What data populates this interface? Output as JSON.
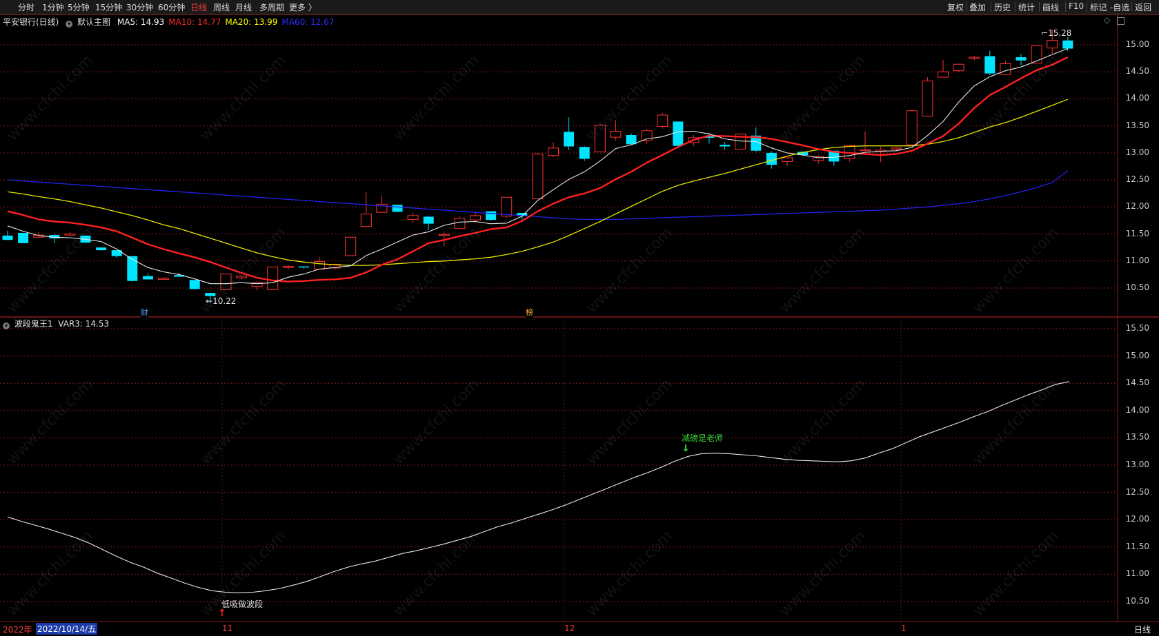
{
  "periods": [
    "分时",
    "1分钟",
    "5分钟",
    "15分钟",
    "30分钟",
    "60分钟",
    "日线",
    "周线",
    "月线",
    "多周期",
    "更多 〉"
  ],
  "active_period": "日线",
  "right_buttons": [
    "复权",
    "叠加",
    "历史",
    "统计",
    "画线",
    "F10",
    "标记",
    "-自选",
    "返回"
  ],
  "main_header": {
    "symbol": "平安银行(日线)",
    "template": "默认主图",
    "ma": [
      {
        "label": "MA5: 14.93",
        "color": "#ffffff"
      },
      {
        "label": "MA10: 14.77",
        "color": "#ff2a2a"
      },
      {
        "label": "MA20: 13.99",
        "color": "#ffff00"
      },
      {
        "label": "MA60: 12.67",
        "color": "#2b2bff"
      }
    ]
  },
  "indicator_header": {
    "name": "波段鬼王1",
    "value": "VAR3: 14.53"
  },
  "main_axis": [
    "15.00",
    "14.50",
    "14.00",
    "13.50",
    "13.00",
    "12.50",
    "12.00",
    "11.50",
    "11.00",
    "10.50"
  ],
  "sub_axis": [
    "15.50",
    "15.00",
    "14.50",
    "14.00",
    "13.50",
    "13.00",
    "12.50",
    "12.00",
    "11.50",
    "11.00",
    "10.50"
  ],
  "annotations": {
    "high": "15.28",
    "low": "10.22",
    "buy": "低吸做波段",
    "sell": "减磅是老师"
  },
  "event_markers": {
    "fin": "财",
    "rank": "榜"
  },
  "x_labels": {
    "year": "2022年",
    "date": "2022/10/14/五",
    "nov": "11",
    "dec": "12",
    "jan": "1",
    "period": "日线"
  },
  "watermark": "www.cfchi.com",
  "colors": {
    "up": "#ff3232",
    "down": "#00e5ff",
    "ma5": "#e8e8e8",
    "ma10": "#ff2020",
    "ma20": "#e6e600",
    "ma60": "#2222ee",
    "grid": "#8b1a1a",
    "var3": "#e8e8e8",
    "sell": "#3ad23a",
    "buy": "#ff2020"
  },
  "candles": [
    [
      11.47,
      11.56,
      11.39,
      11.39
    ],
    [
      11.52,
      11.52,
      11.33,
      11.33
    ],
    [
      11.44,
      11.54,
      11.44,
      11.48
    ],
    [
      11.48,
      11.5,
      11.33,
      11.42
    ],
    [
      11.48,
      11.54,
      11.48,
      11.5
    ],
    [
      11.47,
      11.47,
      11.33,
      11.34
    ],
    [
      11.25,
      11.25,
      11.19,
      11.2
    ],
    [
      11.2,
      11.2,
      11.06,
      11.09
    ],
    [
      11.09,
      11.09,
      10.62,
      10.63
    ],
    [
      10.72,
      10.77,
      10.66,
      10.66
    ],
    [
      10.68,
      10.7,
      10.66,
      10.68
    ],
    [
      10.74,
      10.78,
      10.7,
      10.71
    ],
    [
      10.65,
      10.65,
      10.48,
      10.48
    ],
    [
      10.41,
      10.41,
      10.22,
      10.35
    ],
    [
      10.47,
      10.76,
      10.47,
      10.76
    ],
    [
      10.69,
      10.72,
      10.66,
      10.72
    ],
    [
      10.53,
      10.62,
      10.46,
      10.6
    ],
    [
      10.47,
      10.89,
      10.47,
      10.89
    ],
    [
      10.9,
      10.93,
      10.84,
      10.9
    ],
    [
      10.9,
      10.9,
      10.86,
      10.88
    ],
    [
      10.85,
      11.07,
      10.85,
      10.99
    ],
    [
      10.87,
      10.95,
      10.84,
      10.94
    ],
    [
      11.1,
      11.44,
      11.1,
      11.44
    ],
    [
      11.64,
      12.27,
      11.64,
      11.87
    ],
    [
      11.9,
      12.21,
      11.9,
      12.05
    ],
    [
      12.04,
      12.04,
      11.9,
      11.91
    ],
    [
      11.77,
      11.9,
      11.7,
      11.84
    ],
    [
      11.82,
      11.84,
      11.57,
      11.69
    ],
    [
      11.49,
      11.54,
      11.27,
      11.49
    ],
    [
      11.6,
      11.83,
      11.6,
      11.79
    ],
    [
      11.76,
      11.91,
      11.71,
      11.84
    ],
    [
      11.92,
      11.92,
      11.74,
      11.76
    ],
    [
      11.83,
      12.19,
      11.8,
      12.18
    ],
    [
      11.89,
      11.89,
      11.75,
      11.83
    ],
    [
      12.15,
      13.0,
      12.15,
      12.98
    ],
    [
      12.95,
      13.2,
      12.92,
      13.09
    ],
    [
      13.39,
      13.66,
      13.05,
      13.12
    ],
    [
      13.11,
      13.12,
      12.85,
      12.89
    ],
    [
      13.02,
      13.53,
      13.02,
      13.51
    ],
    [
      13.29,
      13.61,
      13.23,
      13.4
    ],
    [
      13.33,
      13.36,
      13.17,
      13.16
    ],
    [
      13.23,
      13.44,
      13.16,
      13.41
    ],
    [
      13.49,
      13.74,
      13.45,
      13.7
    ],
    [
      13.58,
      13.58,
      13.09,
      13.13
    ],
    [
      13.19,
      13.33,
      13.13,
      13.28
    ],
    [
      13.31,
      13.37,
      13.17,
      13.28
    ],
    [
      13.15,
      13.2,
      13.06,
      13.12
    ],
    [
      13.07,
      13.36,
      13.07,
      13.35
    ],
    [
      13.32,
      13.47,
      13.02,
      13.04
    ],
    [
      13.0,
      13.03,
      12.71,
      12.78
    ],
    [
      12.84,
      12.9,
      12.76,
      12.91
    ],
    [
      13.02,
      13.03,
      12.94,
      12.96
    ],
    [
      12.86,
      12.96,
      12.8,
      12.93
    ],
    [
      13.04,
      13.04,
      12.76,
      12.84
    ],
    [
      12.89,
      13.15,
      12.84,
      13.14
    ],
    [
      13.05,
      13.4,
      13.05,
      13.06
    ],
    [
      13.03,
      13.11,
      12.83,
      13.05
    ],
    [
      13.08,
      13.1,
      13.04,
      13.09
    ],
    [
      13.15,
      13.78,
      13.15,
      13.78
    ],
    [
      13.68,
      14.4,
      13.68,
      14.33
    ],
    [
      14.4,
      14.72,
      14.4,
      14.5
    ],
    [
      14.52,
      14.65,
      14.5,
      14.64
    ],
    [
      14.76,
      14.8,
      14.71,
      14.77
    ],
    [
      14.79,
      14.89,
      14.44,
      14.47
    ],
    [
      14.45,
      14.7,
      14.45,
      14.65
    ],
    [
      14.77,
      14.83,
      14.62,
      14.71
    ],
    [
      14.66,
      14.98,
      14.66,
      14.98
    ],
    [
      14.94,
      15.28,
      14.84,
      15.08
    ],
    [
      15.08,
      15.14,
      14.88,
      14.93
    ]
  ],
  "ma5": [
    11.65,
    11.55,
    11.47,
    11.44,
    11.43,
    11.4,
    11.36,
    11.22,
    11.03,
    10.88,
    10.8,
    10.75,
    10.67,
    10.58,
    10.58,
    10.6,
    10.58,
    10.6,
    10.7,
    10.76,
    10.85,
    10.88,
    10.91,
    11.1,
    11.22,
    11.35,
    11.48,
    11.54,
    11.66,
    11.72,
    11.73,
    11.69,
    11.7,
    11.83,
    12.12,
    12.32,
    12.51,
    12.65,
    12.85,
    13.08,
    13.15,
    13.26,
    13.3,
    13.39,
    13.4,
    13.35,
    13.26,
    13.22,
    13.21,
    13.09,
    13.0,
    12.96,
    12.91,
    12.92,
    12.95,
    13.01,
    13.03,
    13.04,
    13.1,
    13.32,
    13.58,
    13.94,
    14.24,
    14.41,
    14.52,
    14.59,
    14.7,
    14.82,
    14.93
  ],
  "ma10": [
    11.92,
    11.85,
    11.77,
    11.73,
    11.71,
    11.67,
    11.62,
    11.55,
    11.43,
    11.31,
    11.22,
    11.14,
    11.07,
    10.98,
    10.88,
    10.78,
    10.69,
    10.64,
    10.62,
    10.63,
    10.65,
    10.66,
    10.69,
    10.79,
    10.93,
    11.03,
    11.18,
    11.33,
    11.39,
    11.46,
    11.52,
    11.59,
    11.62,
    11.74,
    11.92,
    12.06,
    12.18,
    12.25,
    12.35,
    12.51,
    12.65,
    12.82,
    12.96,
    13.11,
    13.24,
    13.32,
    13.31,
    13.3,
    13.29,
    13.26,
    13.2,
    13.14,
    13.07,
    13.02,
    13.0,
    12.98,
    12.96,
    12.98,
    13.04,
    13.17,
    13.31,
    13.54,
    13.83,
    14.07,
    14.22,
    14.38,
    14.53,
    14.63,
    14.77
  ],
  "ma20": [
    12.28,
    12.24,
    12.19,
    12.15,
    12.1,
    12.04,
    11.98,
    11.91,
    11.84,
    11.76,
    11.67,
    11.6,
    11.51,
    11.42,
    11.33,
    11.24,
    11.15,
    11.08,
    11.02,
    10.98,
    10.95,
    10.93,
    10.92,
    10.92,
    10.93,
    10.95,
    10.97,
    10.99,
    11.0,
    11.02,
    11.04,
    11.07,
    11.12,
    11.18,
    11.26,
    11.35,
    11.47,
    11.6,
    11.73,
    11.87,
    12.01,
    12.15,
    12.29,
    12.4,
    12.48,
    12.55,
    12.62,
    12.7,
    12.78,
    12.86,
    12.94,
    13.01,
    13.06,
    13.1,
    13.12,
    13.13,
    13.13,
    13.13,
    13.13,
    13.16,
    13.21,
    13.28,
    13.38,
    13.48,
    13.56,
    13.66,
    13.77,
    13.88,
    13.99
  ],
  "ma60": [
    12.5,
    12.48,
    12.46,
    12.44,
    12.42,
    12.4,
    12.38,
    12.36,
    12.34,
    12.32,
    12.3,
    12.28,
    12.26,
    12.24,
    12.22,
    12.2,
    12.18,
    12.16,
    12.14,
    12.12,
    12.1,
    12.08,
    12.06,
    12.04,
    12.02,
    12.0,
    11.98,
    11.96,
    11.94,
    11.92,
    11.9,
    11.88,
    11.86,
    11.84,
    11.82,
    11.8,
    11.78,
    11.77,
    11.77,
    11.77,
    11.78,
    11.79,
    11.8,
    11.81,
    11.82,
    11.83,
    11.84,
    11.85,
    11.86,
    11.87,
    11.88,
    11.89,
    11.9,
    11.91,
    11.92,
    11.93,
    11.94,
    11.96,
    11.98,
    12.0,
    12.03,
    12.06,
    12.1,
    12.15,
    12.21,
    12.28,
    12.36,
    12.45,
    12.67
  ],
  "var3": [
    12.05,
    11.97,
    11.9,
    11.83,
    11.75,
    11.67,
    11.57,
    11.45,
    11.33,
    11.22,
    11.13,
    11.02,
    10.93,
    10.84,
    10.76,
    10.7,
    10.67,
    10.66,
    10.67,
    10.7,
    10.74,
    10.8,
    10.87,
    10.96,
    11.05,
    11.13,
    11.19,
    11.24,
    11.31,
    11.38,
    11.43,
    11.49,
    11.55,
    11.62,
    11.69,
    11.78,
    11.87,
    11.94,
    12.02,
    12.1,
    12.18,
    12.27,
    12.37,
    12.47,
    12.57,
    12.67,
    12.77,
    12.86,
    12.96,
    13.07,
    13.16,
    13.21,
    13.22,
    13.21,
    13.19,
    13.17,
    13.14,
    13.11,
    13.09,
    13.08,
    13.07,
    13.06,
    13.08,
    13.13,
    13.22,
    13.3,
    13.41,
    13.52,
    13.61,
    13.7,
    13.79,
    13.89,
    13.98,
    14.09,
    14.19,
    14.29,
    14.38,
    14.48,
    14.53
  ]
}
